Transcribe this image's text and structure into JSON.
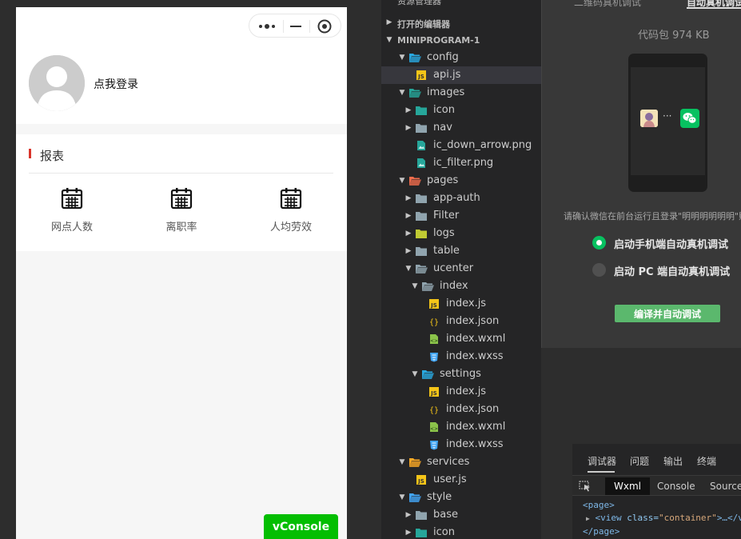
{
  "simulator": {
    "login_text": "点我登录",
    "report": {
      "title": "报表",
      "items": [
        {
          "label": "网点人数",
          "icon": "calendar-icon"
        },
        {
          "label": "离职率",
          "icon": "calendar-icon"
        },
        {
          "label": "人均劳效",
          "icon": "calendar-icon"
        }
      ]
    },
    "vconsole_label": "vConsole"
  },
  "explorer": {
    "heading": "资源管理器",
    "open_editors": "打开的编辑器",
    "project": "MINIPROGRAM-1",
    "tree": [
      {
        "label": "config",
        "level": 1,
        "kind": "folder-open",
        "color": "#29a8e0"
      },
      {
        "label": "api.js",
        "level": 2,
        "kind": "js",
        "selected": true
      },
      {
        "label": "images",
        "level": 1,
        "kind": "folder-open",
        "color": "#26a69a"
      },
      {
        "label": "icon",
        "level": 2,
        "kind": "folder",
        "color": "#26a69a"
      },
      {
        "label": "nav",
        "level": 2,
        "kind": "folder",
        "color": "#90a4ae"
      },
      {
        "label": "ic_down_arrow.png",
        "level": 2,
        "kind": "image"
      },
      {
        "label": "ic_filter.png",
        "level": 2,
        "kind": "image"
      },
      {
        "label": "pages",
        "level": 1,
        "kind": "folder-open",
        "color": "#ef6c4c"
      },
      {
        "label": "app-auth",
        "level": 2,
        "kind": "folder",
        "color": "#90a4ae"
      },
      {
        "label": "Filter",
        "level": 2,
        "kind": "folder",
        "color": "#90a4ae"
      },
      {
        "label": "logs",
        "level": 2,
        "kind": "folder",
        "color": "#c0ca33"
      },
      {
        "label": "table",
        "level": 2,
        "kind": "folder",
        "color": "#90a4ae"
      },
      {
        "label": "ucenter",
        "level": 2,
        "kind": "folder-open",
        "color": "#90a4ae"
      },
      {
        "label": "index",
        "level": 3,
        "kind": "folder-open",
        "color": "#90a4ae"
      },
      {
        "label": "index.js",
        "level": 4,
        "kind": "js"
      },
      {
        "label": "index.json",
        "level": 4,
        "kind": "json"
      },
      {
        "label": "index.wxml",
        "level": 4,
        "kind": "wxml"
      },
      {
        "label": "index.wxss",
        "level": 4,
        "kind": "wxss"
      },
      {
        "label": "settings",
        "level": 3,
        "kind": "folder-open",
        "color": "#29a8e0"
      },
      {
        "label": "index.js",
        "level": 4,
        "kind": "js"
      },
      {
        "label": "index.json",
        "level": 4,
        "kind": "json"
      },
      {
        "label": "index.wxml",
        "level": 4,
        "kind": "wxml"
      },
      {
        "label": "index.wxss",
        "level": 4,
        "kind": "wxss"
      },
      {
        "label": "services",
        "level": 1,
        "kind": "folder-open",
        "color": "#f9a825"
      },
      {
        "label": "user.js",
        "level": 2,
        "kind": "js"
      },
      {
        "label": "style",
        "level": 1,
        "kind": "folder-open",
        "color": "#42a5f5"
      },
      {
        "label": "base",
        "level": 2,
        "kind": "folder",
        "color": "#90a4ae"
      },
      {
        "label": "icon",
        "level": 2,
        "kind": "folder",
        "color": "#26a69a"
      }
    ]
  },
  "remote_debug": {
    "tab_qrcode": "二维码真机调试",
    "tab_auto": "自动真机调试",
    "package_size": "代码包 974 KB",
    "confirm_text": "请确认微信在前台运行且登录\"明明明明明明\"账",
    "option_phone": "启动手机端自动真机调试",
    "option_pc": "启动 PC 端自动真机调试",
    "compile_button": "编译并自动调试"
  },
  "debugger": {
    "tabs": [
      "调试器",
      "问题",
      "输出",
      "终端"
    ],
    "devtools_tabs": [
      "Wxml",
      "Console",
      "Sources"
    ],
    "code": {
      "page_open": "<page>",
      "view_tag_open": "<view",
      "attr_name": "class=",
      "attr_value": "\"container\"",
      "view_rest": ">…</v",
      "page_close": "</page>"
    }
  }
}
